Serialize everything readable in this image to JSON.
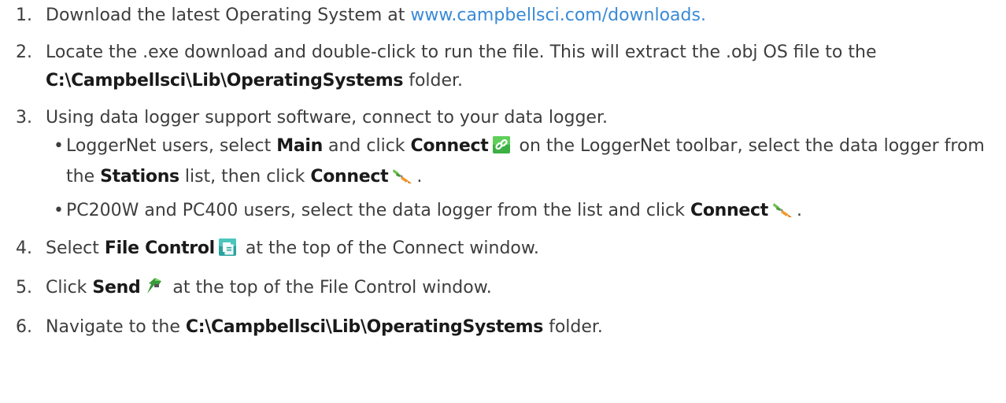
{
  "steps": [
    {
      "number": "1.",
      "text_before": "Download the latest Operating System at ",
      "link": "www.campbellsci.com/downloads."
    },
    {
      "number": "2.",
      "text_before": "Locate the .exe download and double-click to run the file. This will extract the .obj OS file to the ",
      "bold": "C:\\Campbellsci\\Lib\\OperatingSystems",
      "text_after": " folder."
    },
    {
      "number": "3.",
      "text": "Using data logger support software, connect to your data logger.",
      "sub": [
        {
          "bullet": "•",
          "t1": "LoggerNet users, select ",
          "b1": "Main",
          "t2": " and click ",
          "b2": "Connect",
          "t3": " on the LoggerNet toolbar, select the data logger from the ",
          "b3": "Stations",
          "t4": " list, then click ",
          "b4": "Connect",
          "t5": "."
        },
        {
          "bullet": "•",
          "t1": "PC200W and PC400 users, select the data logger from the list and click ",
          "b1": "Connect",
          "t2": "."
        }
      ]
    },
    {
      "number": "4.",
      "text_before": "Select ",
      "bold": "File Control",
      "text_after": " at the top of the Connect window."
    },
    {
      "number": "5.",
      "text_before": "Click ",
      "bold": "Send",
      "text_after": " at the top of the File Control window."
    },
    {
      "number": "6.",
      "text_before": "Navigate to the ",
      "bold": "C:\\Campbellsci\\Lib\\OperatingSystems",
      "text_after": " folder."
    }
  ],
  "icons": {
    "connect_toolbar": "chain-link-icon",
    "connect_plug": "plug-connect-icon",
    "file_control": "file-control-icon",
    "send": "send-arrow-icon"
  },
  "colors": {
    "text": "#3d3d3d",
    "bold": "#1a1a1a",
    "link": "#3a8ad6"
  }
}
